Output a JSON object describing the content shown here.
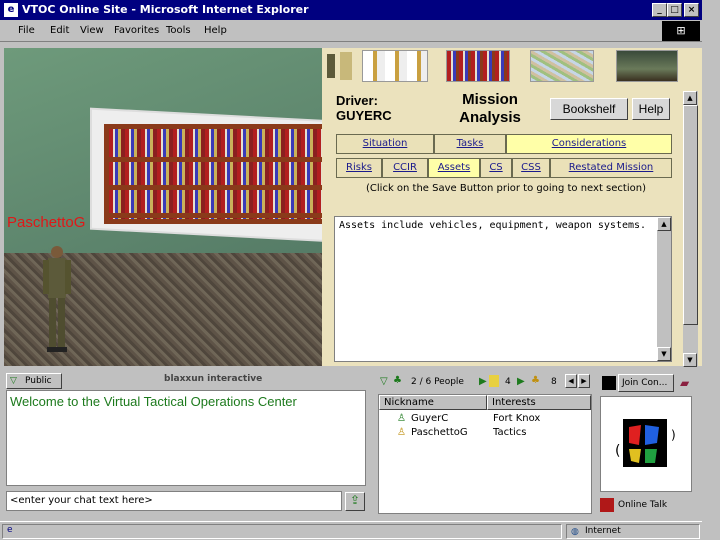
{
  "window": {
    "title": "VTOC Online Site - Microsoft Internet Explorer",
    "min": "_",
    "max": "□",
    "close": "×"
  },
  "menu": [
    "File",
    "Edit",
    "View",
    "Favorites",
    "Tools",
    "Help"
  ],
  "scene": {
    "avatar_name": "PaschettoG"
  },
  "panel": {
    "driver_label": "Driver:",
    "driver_name": "GUYERC",
    "title_line1": "Mission",
    "title_line2": "Analysis",
    "bookshelf_button": "Bookshelf",
    "help_button": "Help",
    "tabs_row1": [
      "Situation",
      "Tasks",
      "Considerations"
    ],
    "tabs_row2": [
      "Risks",
      "CCIR",
      "Assets",
      "CS",
      "CSS",
      "Restated Mission"
    ],
    "active_tab": "Assets",
    "note": "(Click on the Save Button prior to going to next section)",
    "text": "Assets include vehicles, equipment, weapon systems."
  },
  "chat": {
    "mode": "Public",
    "brand": "blaxxun interactive",
    "log": "Welcome to the Virtual Tactical Operations Center",
    "input_placeholder": "<enter your chat text here>"
  },
  "people": {
    "count_label": "2 / 6 People",
    "page1": "4",
    "page2": "8",
    "columns": [
      "Nickname",
      "Interests"
    ],
    "rows": [
      {
        "nick": "GuyerC",
        "interest": "Fort Knox"
      },
      {
        "nick": "PaschettoG",
        "interest": "Tactics"
      }
    ]
  },
  "community": {
    "join_label": "Join Con...",
    "talk_label": "Online Talk"
  },
  "status": {
    "zone": "Internet"
  }
}
